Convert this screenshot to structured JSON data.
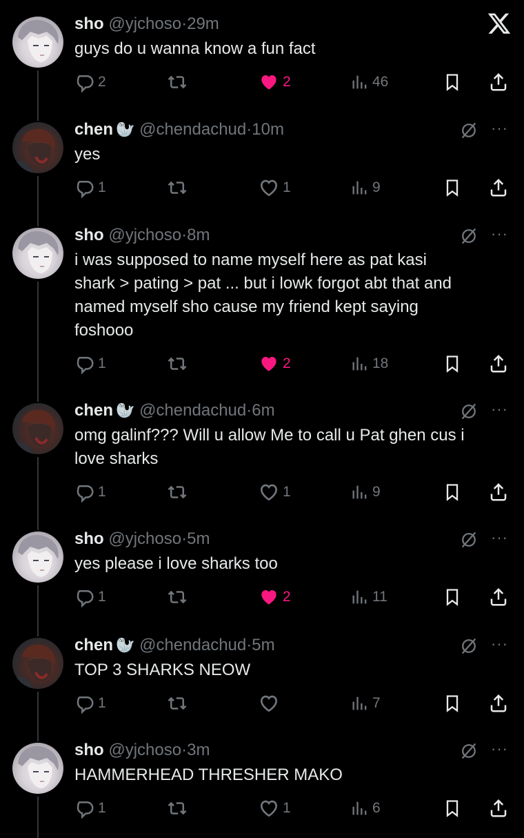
{
  "close_icon_glyph": "X",
  "tweets": [
    {
      "author": "sho",
      "handle": "@yjchoso",
      "time": "29m",
      "text": [
        "guys do u wanna know a fun fact"
      ],
      "replies": "2",
      "likes": "2",
      "liked": true,
      "views": "46",
      "avatar": "sho"
    },
    {
      "author": "chen",
      "handle": "@chendachud",
      "time": "10m",
      "text": [
        "yes"
      ],
      "replies": "1",
      "likes": "1",
      "liked": false,
      "views": "9",
      "avatar": "chen"
    },
    {
      "author": "sho",
      "handle": "@yjchoso",
      "time": "8m",
      "text": [
        "i was supposed to name myself here as pat kasi",
        "shark > pating > pat ... but i lowk forgot abt that and",
        "named myself sho cause my friend kept saying",
        "foshooo"
      ],
      "replies": "1",
      "likes": "2",
      "liked": true,
      "views": "18",
      "avatar": "sho"
    },
    {
      "author": "chen",
      "handle": "@chendachud",
      "time": "6m",
      "text": [
        "omg galinf??? Will u allow Me to call u Pat ghen cus i",
        "love sharks"
      ],
      "replies": "1",
      "likes": "1",
      "liked": false,
      "views": "9",
      "avatar": "chen"
    },
    {
      "author": "sho",
      "handle": "@yjchoso",
      "time": "5m",
      "text": [
        "yes please i love sharks too"
      ],
      "replies": "1",
      "likes": "2",
      "liked": true,
      "views": "11",
      "avatar": "sho"
    },
    {
      "author": "chen",
      "handle": "@chendachud",
      "time": "5m",
      "text": [
        "TOP 3 SHARKS NEOW"
      ],
      "replies": "1",
      "likes": "",
      "liked": false,
      "views": "7",
      "avatar": "chen"
    },
    {
      "author": "sho",
      "handle": "@yjchoso",
      "time": "3m",
      "text": [
        "HAMMERHEAD THRESHER MAKO"
      ],
      "replies": "1",
      "likes": "1",
      "liked": false,
      "views": "6",
      "avatar": "sho"
    }
  ],
  "dot": "·",
  "seal_emoji": "🦭",
  "more_glyph": "···",
  "colors": {
    "like": "#f91880",
    "muted": "#71767b",
    "text": "#e7e9ea",
    "bg": "#000000"
  }
}
